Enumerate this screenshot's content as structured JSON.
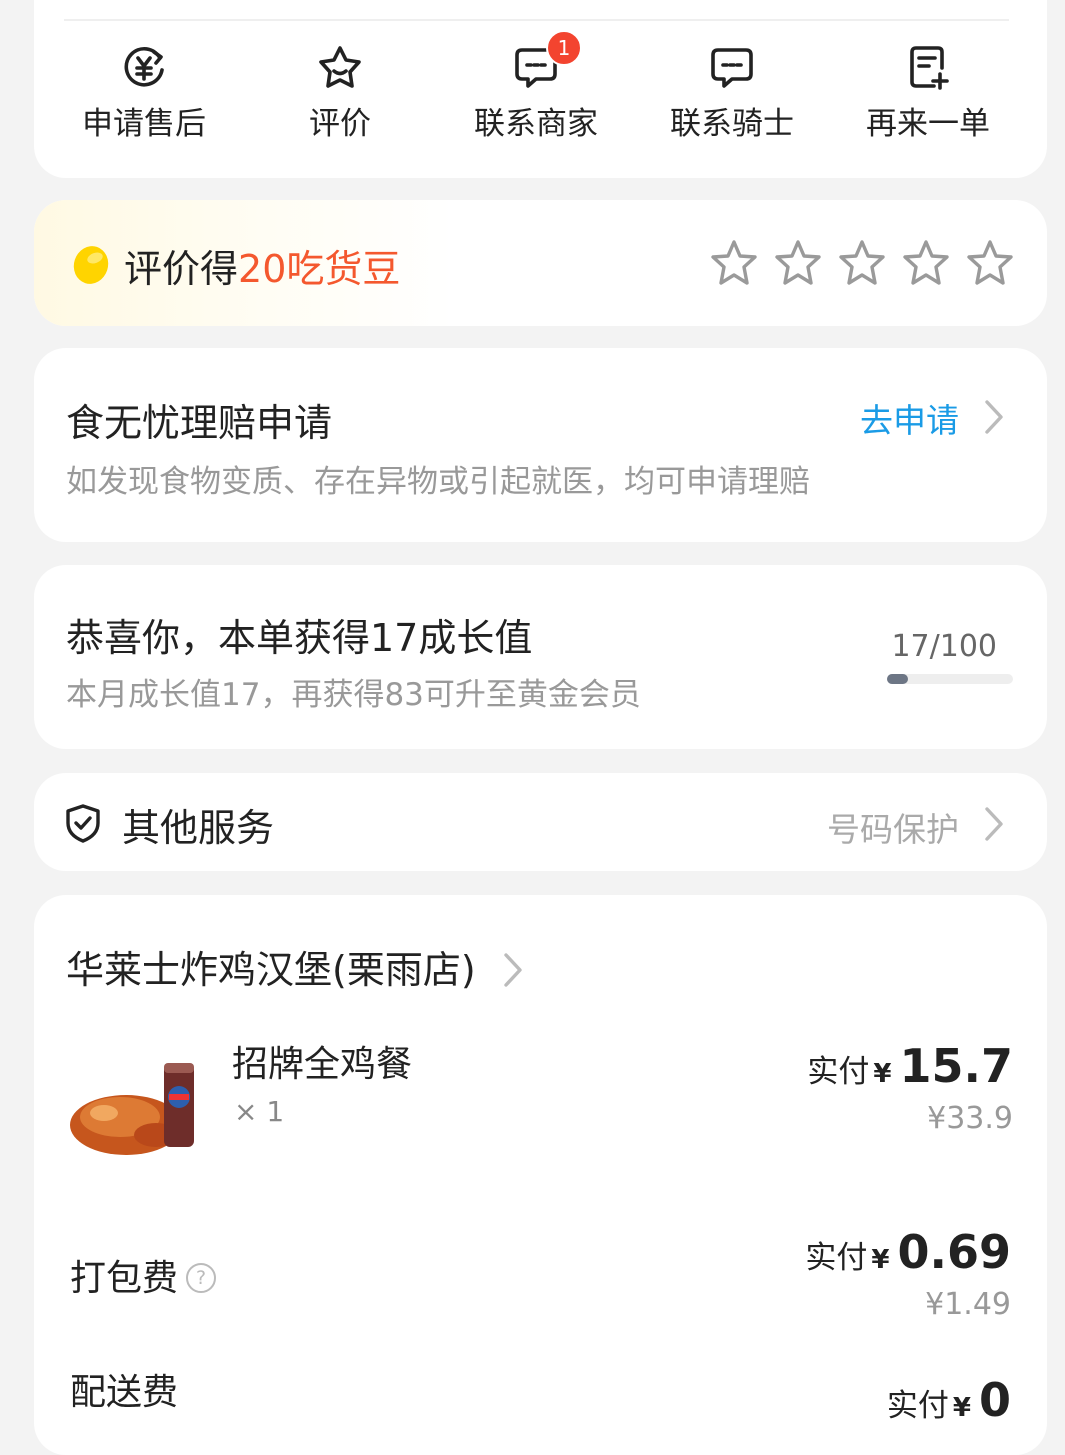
{
  "actions": [
    {
      "label": "申请售后",
      "icon": "refund-yen-icon"
    },
    {
      "label": "评价",
      "icon": "star-icon"
    },
    {
      "label": "联系商家",
      "icon": "chat-icon",
      "badge": "1"
    },
    {
      "label": "联系骑士",
      "icon": "chat-icon"
    },
    {
      "label": "再来一单",
      "icon": "reorder-doc-icon"
    }
  ],
  "rating": {
    "prefix": "评价得",
    "highlight": "20吃货豆",
    "stars": 5,
    "highlight_color": "#f4582e"
  },
  "claim": {
    "title": "食无忧理赔申请",
    "subtitle": "如发现食物变质、存在异物或引起就医，均可申请理赔",
    "action": "去申请"
  },
  "growth": {
    "title": "恭喜你，本单获得17成长值",
    "subtitle": "本月成长值17，再获得83可升至黄金会员",
    "progress_text": "17/100",
    "progress_value": 17,
    "progress_max": 100
  },
  "other_services": {
    "title": "其他服务",
    "value": "号码保护"
  },
  "order": {
    "shop_name": "华莱士炸鸡汉堡(栗雨店)",
    "item": {
      "name": "招牌全鸡餐",
      "qty": "× 1",
      "pay_label": "实付",
      "currency": "¥",
      "pay_amount": "15.7",
      "original": "¥33.9"
    },
    "packing": {
      "label": "打包费",
      "help": "?",
      "pay_label": "实付",
      "currency": "¥",
      "pay_amount": "0.69",
      "original": "¥1.49"
    },
    "delivery": {
      "label": "配送费",
      "pay_label": "实付",
      "currency": "¥",
      "pay_amount": "0"
    }
  },
  "colors": {
    "accent_blue": "#1a9be6",
    "badge_red": "#f3442f",
    "bean_yellow": "#ffd400"
  }
}
